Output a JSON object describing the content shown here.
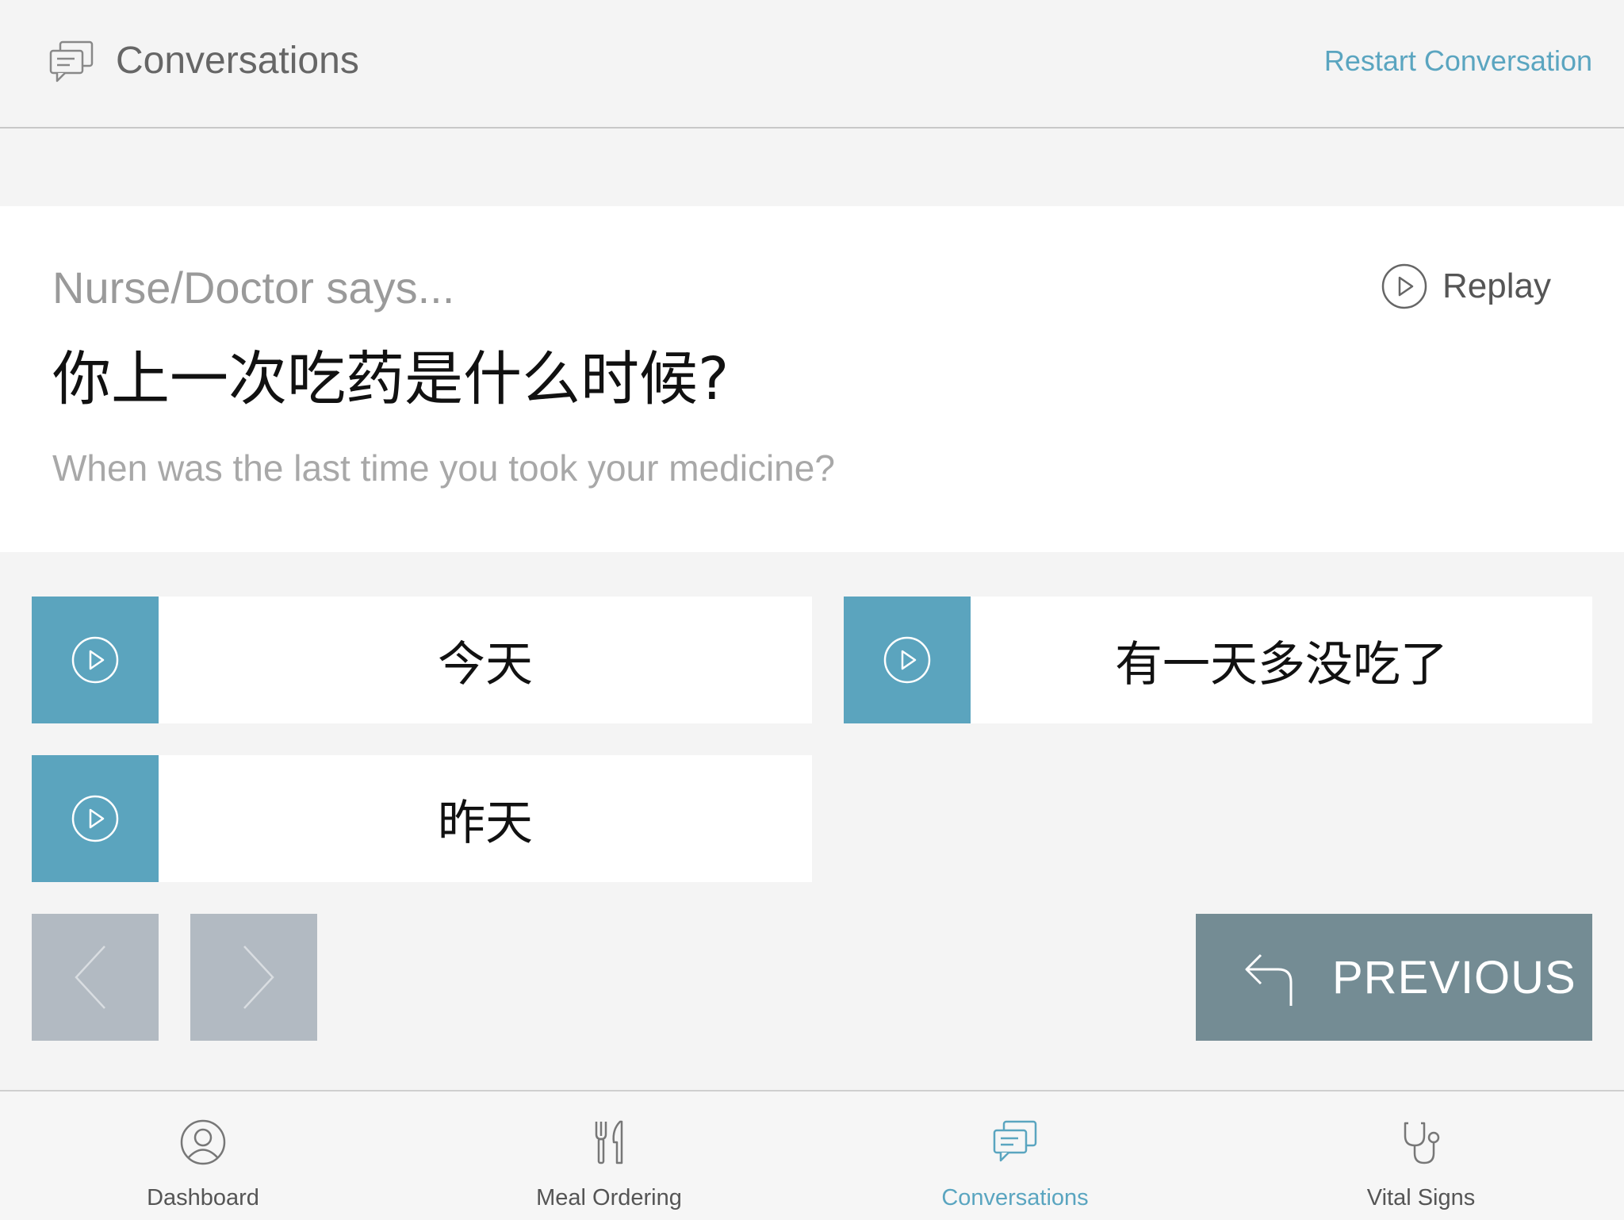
{
  "header": {
    "title": "Conversations",
    "icon": "chat-bubbles-icon",
    "restart_label": "Restart Conversation"
  },
  "question": {
    "speaker": "Nurse/Doctor says...",
    "replay_label": "Replay",
    "text_zh": "你上一次吃药是什么时候?",
    "text_en": "When was the last time you took your medicine?"
  },
  "answers": [
    {
      "label": "今天"
    },
    {
      "label": "有一天多没吃了"
    },
    {
      "label": "昨天"
    }
  ],
  "navigation": {
    "previous_label": "PREVIOUS"
  },
  "tabs": [
    {
      "label": "Dashboard",
      "icon": "user-icon",
      "active": false
    },
    {
      "label": "Meal Ordering",
      "icon": "utensils-icon",
      "active": false
    },
    {
      "label": "Conversations",
      "icon": "chat-bubbles-icon",
      "active": true
    },
    {
      "label": "Vital Signs",
      "icon": "stethoscope-icon",
      "active": false
    }
  ],
  "colors": {
    "accent": "#5aa5c0",
    "play_tile": "#5ba4be",
    "previous_button": "#748c94",
    "nav_disabled": "#b2bac2"
  }
}
